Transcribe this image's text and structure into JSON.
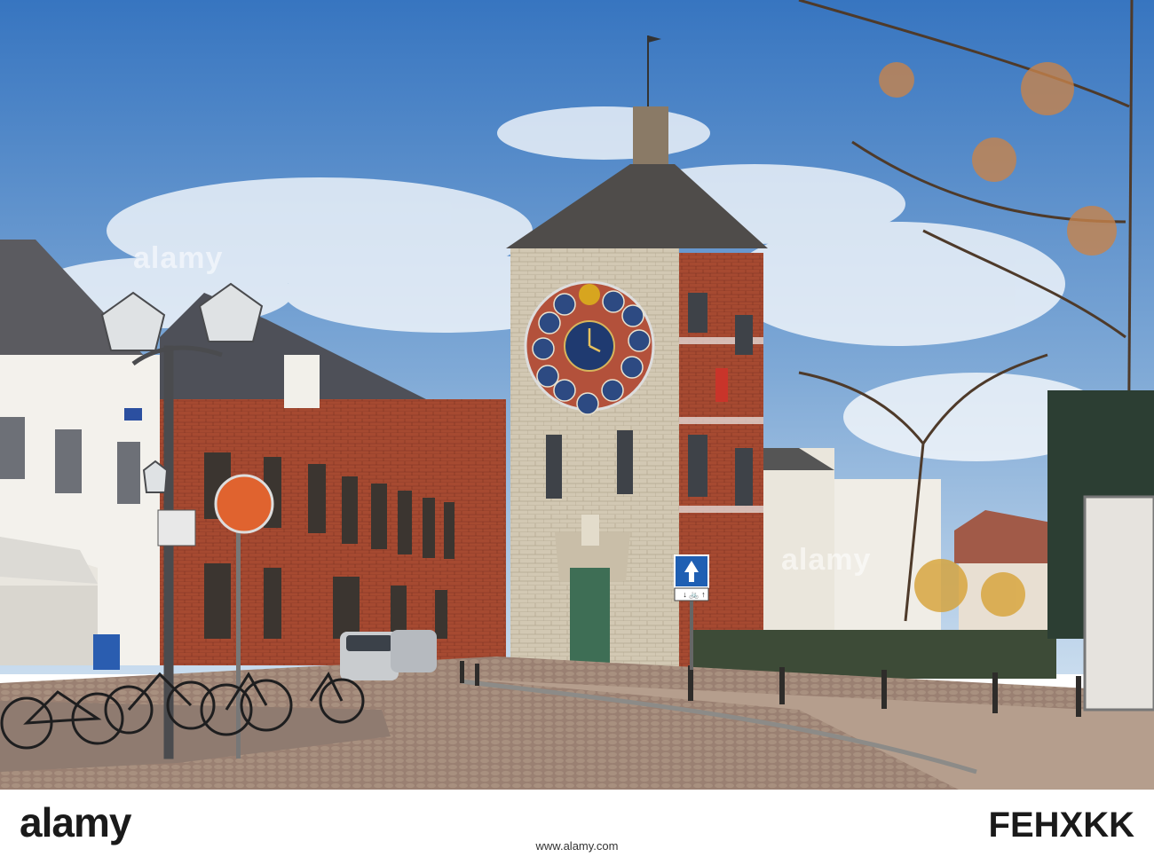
{
  "watermark": {
    "text": "alamy"
  },
  "street_sign": {
    "text": "↓ 🚲 ↑"
  },
  "footer": {
    "brand": "alamy",
    "image_id": "FEHXKK",
    "url": "www.alamy.com"
  },
  "colors": {
    "sky_top": "#3a7fc7",
    "sky_bottom": "#bcd4ea",
    "brick": "#a8482f",
    "stone": "#cfc4ae",
    "clock_face": "#b5513a",
    "cobble": "#9a8172"
  }
}
